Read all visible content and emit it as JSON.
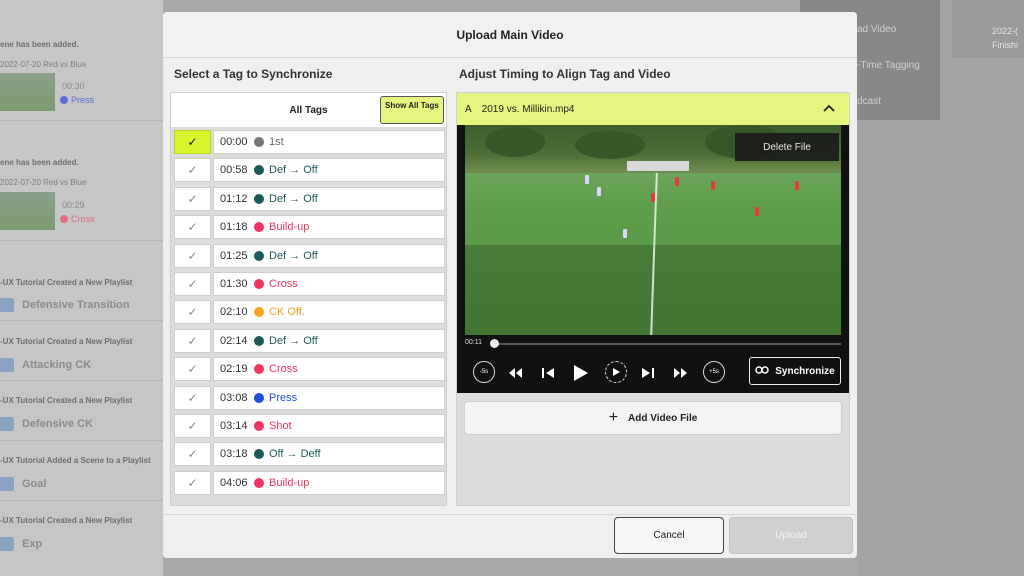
{
  "background": {
    "feed": [
      {
        "notice": "ene has been added.",
        "date": "2022-07-20 Red vs Blue",
        "time": "00:30",
        "tag": "Press",
        "tag_color": "#5b6fd6"
      },
      {
        "notice": "ene has been added.",
        "date": "2022-07-20 Red vs Blue",
        "time": "00:29",
        "tag": "Cross",
        "tag_color": "#e07080"
      }
    ],
    "playlists": [
      {
        "header": "-UX Tutorial Created a New Playlist",
        "name": "Defensive Transition"
      },
      {
        "header": "-UX Tutorial Created a New Playlist",
        "name": "Attacking CK"
      },
      {
        "header": "-UX Tutorial Created a New Playlist",
        "name": "Defensive CK"
      },
      {
        "header": "-UX Tutorial Added a Scene to a Playlist",
        "name": "Goal"
      },
      {
        "header": "-UX Tutorial Created a New Playlist",
        "name": "Exp"
      }
    ],
    "menu": [
      "ad Video",
      "-Time Tagging",
      "dcast"
    ],
    "card": {
      "date": "2022-(",
      "status": "Finishi"
    }
  },
  "modal": {
    "title": "Upload Main Video",
    "left_title": "Select a Tag to Synchronize",
    "right_title": "Adjust Timing to Align Tag and Video",
    "all_tags": "All Tags",
    "show_all_tags": "Show All Tags",
    "tags": [
      {
        "time": "00:00",
        "label": "1st",
        "color": "#777777",
        "text_color": "#666666",
        "selected": true
      },
      {
        "time": "00:58",
        "label": "Def → Off",
        "color": "#1d5a5a",
        "text_color": "#1d5a5a",
        "selected": false
      },
      {
        "time": "01:12",
        "label": "Def → Off",
        "color": "#1d5a5a",
        "text_color": "#1d5a5a",
        "selected": false
      },
      {
        "time": "01:18",
        "label": "Build-up",
        "color": "#f0365e",
        "text_color": "#e8365e",
        "selected": false
      },
      {
        "time": "01:25",
        "label": "Def → Off",
        "color": "#1d5a5a",
        "text_color": "#1d5a5a",
        "selected": false
      },
      {
        "time": "01:30",
        "label": "Cross",
        "color": "#f0365e",
        "text_color": "#e8365e",
        "selected": false
      },
      {
        "time": "02:10",
        "label": "CK Off.",
        "color": "#f5a623",
        "text_color": "#f0a020",
        "selected": false
      },
      {
        "time": "02:14",
        "label": "Def → Off",
        "color": "#1d5a5a",
        "text_color": "#1d5a5a",
        "selected": false
      },
      {
        "time": "02:19",
        "label": "Cross",
        "color": "#f0365e",
        "text_color": "#e8365e",
        "selected": false
      },
      {
        "time": "03:08",
        "label": "Press",
        "color": "#1f4fd8",
        "text_color": "#1f4fd8",
        "selected": false
      },
      {
        "time": "03:14",
        "label": "Shot",
        "color": "#f0365e",
        "text_color": "#e8365e",
        "selected": false
      },
      {
        "time": "03:18",
        "label": "Off → Deff",
        "color": "#1d5a5a",
        "text_color": "#1d5a5a",
        "selected": false
      },
      {
        "time": "04:06",
        "label": "Build-up",
        "color": "#f0365e",
        "text_color": "#e8365e",
        "selected": false
      }
    ],
    "file": {
      "letter": "A",
      "name": "2019 vs. Millikin.mp4"
    },
    "delete_file": "Delete File",
    "current_time": "00:11",
    "synchronize": "Synchronize",
    "add_video_file": "Add Video File",
    "cancel": "Cancel",
    "upload": "Upload",
    "accent_color": "#e6f57f"
  }
}
